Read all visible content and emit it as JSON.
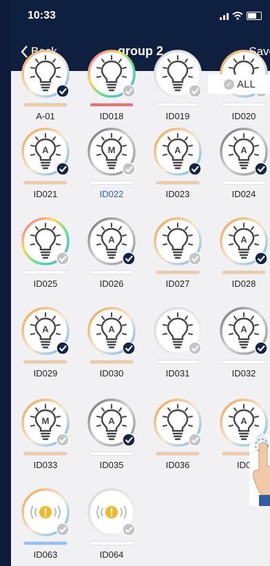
{
  "status": {
    "time": "10:33"
  },
  "nav": {
    "back_label": "Back",
    "title": "group 2",
    "save_label": "Save"
  },
  "select_all": {
    "label": "ALL"
  },
  "colors": {
    "navy": "#0f1f3f",
    "check_on": "#14254a",
    "check_off": "#c4c4c4",
    "peach": "#f3c9a0",
    "red_bar": "#e57373",
    "blue_bar": "#8ec1f5"
  },
  "devices": [
    {
      "label": "A-01",
      "ring": "warm",
      "mode": "",
      "checked": true,
      "bar": "peach",
      "partial": true
    },
    {
      "label": "ID018",
      "ring": "rainbow",
      "mode": "",
      "checked": false,
      "bar": "red",
      "partial": true
    },
    {
      "label": "ID019",
      "ring": "white",
      "mode": "",
      "checked": false,
      "bar": "white",
      "partial": true
    },
    {
      "label": "ID020",
      "ring": "warm",
      "mode": "",
      "checked": false,
      "bar": "white",
      "partial": true
    },
    {
      "label": "ID021",
      "ring": "warm",
      "mode": "A",
      "checked": true,
      "bar": "peach"
    },
    {
      "label": "ID022",
      "ring": "gray",
      "mode": "M",
      "checked": false,
      "bar": "white",
      "selected": true
    },
    {
      "label": "ID023",
      "ring": "warm",
      "mode": "A",
      "checked": true,
      "bar": "peach"
    },
    {
      "label": "ID024",
      "ring": "gray",
      "mode": "A",
      "checked": true,
      "bar": "white"
    },
    {
      "label": "ID025",
      "ring": "rainbow",
      "mode": "",
      "checked": false,
      "bar": "white"
    },
    {
      "label": "ID026",
      "ring": "gray",
      "mode": "A",
      "checked": true,
      "bar": "white"
    },
    {
      "label": "ID027",
      "ring": "warm",
      "mode": "",
      "checked": false,
      "bar": "peach"
    },
    {
      "label": "ID028",
      "ring": "warm",
      "mode": "A",
      "checked": true,
      "bar": "peach"
    },
    {
      "label": "ID029",
      "ring": "warm",
      "mode": "A",
      "checked": true,
      "bar": "peach"
    },
    {
      "label": "ID030",
      "ring": "warm",
      "mode": "A",
      "checked": true,
      "bar": "peach"
    },
    {
      "label": "ID031",
      "ring": "white",
      "mode": "",
      "checked": false,
      "bar": "white"
    },
    {
      "label": "ID032",
      "ring": "gray",
      "mode": "A",
      "checked": true,
      "bar": "white"
    },
    {
      "label": "ID033",
      "ring": "warm",
      "mode": "M",
      "checked": false,
      "bar": "peach"
    },
    {
      "label": "ID035",
      "ring": "gray",
      "mode": "A",
      "checked": true,
      "bar": "white"
    },
    {
      "label": "ID036",
      "ring": "warm",
      "mode": "",
      "checked": false,
      "bar": "peach"
    },
    {
      "label": "ID0",
      "ring": "warm",
      "mode": "A",
      "checked": true,
      "bar": "peach"
    },
    {
      "label": "ID063",
      "ring": "warm",
      "mode": "!",
      "checked": false,
      "bar": "blue",
      "sensor": true
    },
    {
      "label": "ID064",
      "ring": "white",
      "mode": "!",
      "checked": false,
      "bar": "white",
      "sensor": true
    }
  ]
}
